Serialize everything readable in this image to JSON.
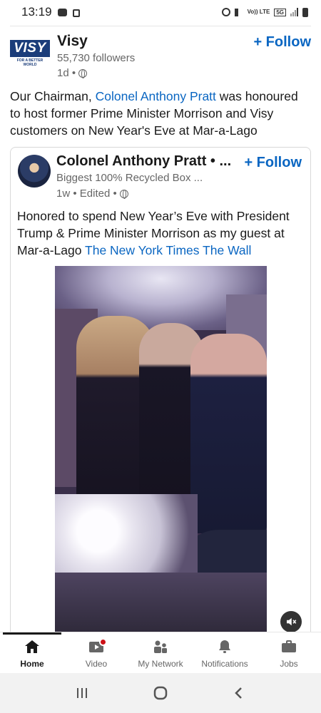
{
  "status_bar": {
    "time": "13:19",
    "lte_label": "Vo)) LTE",
    "network": "5G"
  },
  "post": {
    "company_name": "Visy",
    "logo_text": "VISY",
    "logo_tagline": "FOR A BETTER WORLD",
    "followers": "55,730 followers",
    "time": "1d •",
    "follow_label": "+ Follow",
    "text_before": "Our Chairman, ",
    "mention": "Colonel Anthony Pratt",
    "text_after": " was honoured to host former Prime Minister Morrison and Visy customers on New Year's Eve at Mar-a-Lago"
  },
  "shared": {
    "author": "Colonel Anthony Pratt • ...",
    "follow_label": "+ Follow",
    "headline": "Biggest 100% Recycled Box ...",
    "time": "1w • Edited •",
    "text": "Honored to spend New Year’s Eve with President Trump & Prime Minister Morrison as my guest at Mar-a-Lago ",
    "link_1": "The New York Times",
    "link_2": "The Wall"
  },
  "bottom_nav": {
    "items": [
      {
        "label": "Home",
        "icon": "home-icon",
        "active": true
      },
      {
        "label": "Video",
        "icon": "video-icon"
      },
      {
        "label": "My Network",
        "icon": "network-icon"
      },
      {
        "label": "Notifications",
        "icon": "bell-icon"
      },
      {
        "label": "Jobs",
        "icon": "briefcase-icon"
      }
    ]
  },
  "colors": {
    "brand_blue": "#0a66c2",
    "visy_navy": "#1b3d7a",
    "badge_red": "#cc1016"
  }
}
